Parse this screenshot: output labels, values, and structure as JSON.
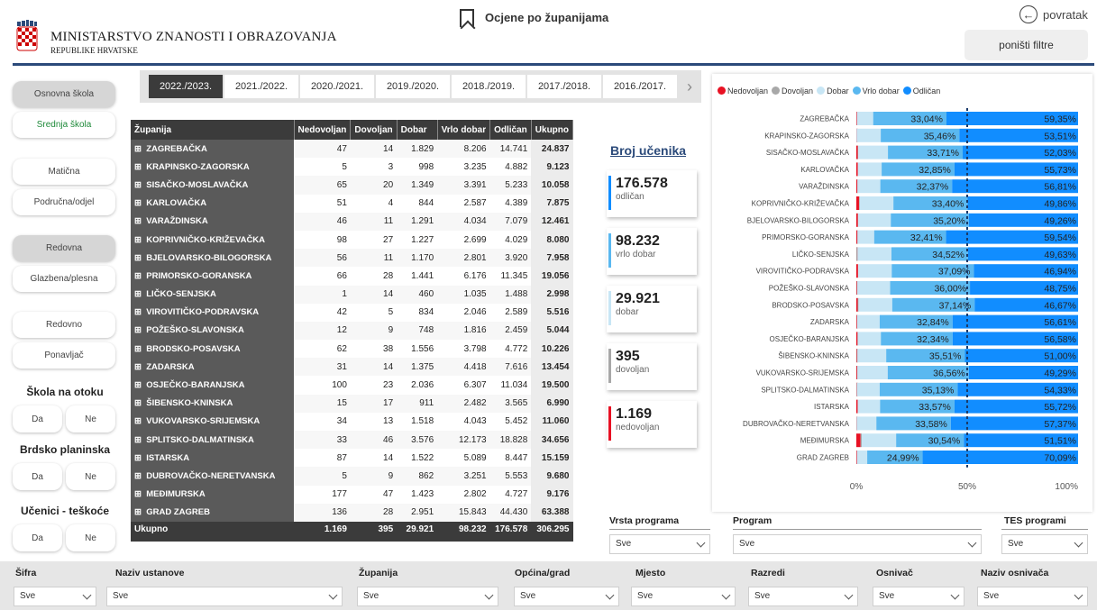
{
  "header": {
    "org_name": "MINISTARSTVO ZNANOSTI I OBRAZOVANJA",
    "org_sub": "REPUBLIKE HRVATSKE",
    "page_title": "Ocjene po županijama",
    "back_label": "povratak",
    "reset_label": "poništi filtre"
  },
  "left_filters": {
    "school_type": [
      "Osnovna škola",
      "Srednja škola"
    ],
    "school_kind": [
      "Matična",
      "Područna/odjel"
    ],
    "program_kind": [
      "Redovna",
      "Glazbena/plesna"
    ],
    "student_kind": [
      "Redovno",
      "Ponavljač"
    ],
    "island_title": "Škola na otoku",
    "mountain_title": "Brdsko planinska",
    "difficulty_title": "Učenici - teškoće",
    "yes": "Da",
    "no": "Ne"
  },
  "year_tabs": [
    "2022./2023.",
    "2021./2022.",
    "2020./2021.",
    "2019./2020.",
    "2018./2019.",
    "2017./2018.",
    "2016./2017."
  ],
  "table": {
    "headers": [
      "Županija",
      "Nedovoljan",
      "Dovoljan",
      "Dobar",
      "Vrlo dobar",
      "Odličan",
      "Ukupno"
    ],
    "rows": [
      {
        "name": "ZAGREBAČKA",
        "v": [
          "47",
          "14",
          "1.829",
          "8.206",
          "14.741",
          "24.837"
        ]
      },
      {
        "name": "KRAPINSKO-ZAGORSKA",
        "v": [
          "5",
          "3",
          "998",
          "3.235",
          "4.882",
          "9.123"
        ]
      },
      {
        "name": "SISAČKO-MOSLAVAČKA",
        "v": [
          "65",
          "20",
          "1.349",
          "3.391",
          "5.233",
          "10.058"
        ]
      },
      {
        "name": "KARLOVAČKA",
        "v": [
          "51",
          "4",
          "844",
          "2.587",
          "4.389",
          "7.875"
        ]
      },
      {
        "name": "VARAŽDINSKA",
        "v": [
          "46",
          "11",
          "1.291",
          "4.034",
          "7.079",
          "12.461"
        ]
      },
      {
        "name": "KOPRIVNIČKO-KRIŽEVAČKA",
        "v": [
          "98",
          "27",
          "1.227",
          "2.699",
          "4.029",
          "8.080"
        ]
      },
      {
        "name": "BJELOVARSKO-BILOGORSKA",
        "v": [
          "56",
          "11",
          "1.170",
          "2.801",
          "3.920",
          "7.958"
        ]
      },
      {
        "name": "PRIMORSKO-GORANSKA",
        "v": [
          "66",
          "28",
          "1.441",
          "6.176",
          "11.345",
          "19.056"
        ]
      },
      {
        "name": "LIČKO-SENJSKA",
        "v": [
          "1",
          "14",
          "460",
          "1.035",
          "1.488",
          "2.998"
        ]
      },
      {
        "name": "VIROVITIČKO-PODRAVSKA",
        "v": [
          "42",
          "5",
          "834",
          "2.046",
          "2.589",
          "5.516"
        ]
      },
      {
        "name": "POŽEŠKO-SLAVONSKA",
        "v": [
          "12",
          "9",
          "748",
          "1.816",
          "2.459",
          "5.044"
        ]
      },
      {
        "name": "BRODSKO-POSAVSKA",
        "v": [
          "62",
          "38",
          "1.556",
          "3.798",
          "4.772",
          "10.226"
        ]
      },
      {
        "name": "ZADARSKA",
        "v": [
          "31",
          "14",
          "1.375",
          "4.418",
          "7.616",
          "13.454"
        ]
      },
      {
        "name": "OSJEČKO-BARANJSKA",
        "v": [
          "100",
          "23",
          "2.036",
          "6.307",
          "11.034",
          "19.500"
        ]
      },
      {
        "name": "ŠIBENSKO-KNINSKA",
        "v": [
          "15",
          "17",
          "911",
          "2.482",
          "3.565",
          "6.990"
        ]
      },
      {
        "name": "VUKOVARSKO-SRIJEMSKA",
        "v": [
          "34",
          "13",
          "1.518",
          "4.043",
          "5.452",
          "11.060"
        ]
      },
      {
        "name": "SPLITSKO-DALMATINSKA",
        "v": [
          "33",
          "46",
          "3.576",
          "12.173",
          "18.828",
          "34.656"
        ]
      },
      {
        "name": "ISTARSKA",
        "v": [
          "87",
          "14",
          "1.522",
          "5.089",
          "8.447",
          "15.159"
        ]
      },
      {
        "name": "DUBROVAČKO-NERETVANSKA",
        "v": [
          "5",
          "9",
          "862",
          "3.251",
          "5.553",
          "9.680"
        ]
      },
      {
        "name": "MEĐIMURSKA",
        "v": [
          "177",
          "47",
          "1.423",
          "2.802",
          "4.727",
          "9.176"
        ]
      },
      {
        "name": "GRAD ZAGREB",
        "v": [
          "136",
          "28",
          "2.951",
          "15.843",
          "44.430",
          "63.388"
        ]
      }
    ],
    "total": {
      "name": "Ukupno",
      "v": [
        "1.169",
        "395",
        "29.921",
        "98.232",
        "176.578",
        "306.295"
      ]
    }
  },
  "cards": {
    "title": "Broj učenika",
    "items": [
      {
        "value": "176.578",
        "label": "odličan",
        "color": "#118dff"
      },
      {
        "value": "98.232",
        "label": "vrlo dobar",
        "color": "#5ab8f0"
      },
      {
        "value": "29.921",
        "label": "dobar",
        "color": "#c8e6f5"
      },
      {
        "value": "395",
        "label": "dovoljan",
        "color": "#a8a8a8"
      },
      {
        "value": "1.169",
        "label": "nedovoljan",
        "color": "#e81123"
      }
    ]
  },
  "chart_data": {
    "type": "bar",
    "orientation": "horizontal-100%-stacked",
    "legend": [
      "Nedovoljan",
      "Dovoljan",
      "Dobar",
      "Vrlo dobar",
      "Odličan"
    ],
    "legend_colors": [
      "#e81123",
      "#a8a8a8",
      "#c8e6f5",
      "#5ab8f0",
      "#118dff"
    ],
    "categories": [
      "ZAGREBAČKA",
      "KRAPINSKO-ZAGORSKA",
      "SISAČKO-MOSLAVAČKA",
      "KARLOVAČKA",
      "VARAŽDINSKA",
      "KOPRIVNIČKO-KRIŽEVAČKA",
      "BJELOVARSKO-BILOGORSKA",
      "PRIMORSKO-GORANSKA",
      "LIČKO-SENJSKA",
      "VIROVITIČKO-PODRAVSKA",
      "POŽEŠKO-SLAVONSKA",
      "BRODSKO-POSAVSKA",
      "ZADARSKA",
      "OSJEČKO-BARANJSKA",
      "ŠIBENSKO-KNINSKA",
      "VUKOVARSKO-SRIJEMSKA",
      "SPLITSKO-DALMATINSKA",
      "ISTARSKA",
      "DUBROVAČKO-NERETVANSKA",
      "MEĐIMURSKA",
      "GRAD ZAGREB"
    ],
    "series": [
      {
        "name": "Nedovoljan",
        "values": [
          0.19,
          0.05,
          0.65,
          0.65,
          0.37,
          1.21,
          0.7,
          0.35,
          0.03,
          0.76,
          0.24,
          0.61,
          0.23,
          0.51,
          0.21,
          0.31,
          0.1,
          0.57,
          0.05,
          1.93,
          0.21
        ]
      },
      {
        "name": "Dovoljan",
        "values": [
          0.06,
          0.03,
          0.2,
          0.05,
          0.09,
          0.33,
          0.14,
          0.15,
          0.47,
          0.09,
          0.18,
          0.37,
          0.1,
          0.12,
          0.24,
          0.12,
          0.13,
          0.09,
          0.09,
          0.51,
          0.04
        ]
      },
      {
        "name": "Dobar",
        "values": [
          7.36,
          10.94,
          13.41,
          10.72,
          10.36,
          15.19,
          14.7,
          7.56,
          15.34,
          15.12,
          14.83,
          15.22,
          10.22,
          10.44,
          13.03,
          13.73,
          10.32,
          10.04,
          8.9,
          15.51,
          4.66
        ]
      },
      {
        "name": "Vrlo dobar",
        "values": [
          33.04,
          35.46,
          33.71,
          32.85,
          32.37,
          33.4,
          35.2,
          32.41,
          34.52,
          37.09,
          36.0,
          37.14,
          32.84,
          32.34,
          35.51,
          36.56,
          35.13,
          33.57,
          33.58,
          30.54,
          24.99
        ]
      },
      {
        "name": "Odličan",
        "values": [
          59.35,
          53.51,
          52.03,
          55.73,
          56.81,
          49.86,
          49.26,
          59.54,
          49.63,
          46.94,
          48.75,
          46.67,
          56.61,
          56.58,
          51.0,
          49.29,
          54.33,
          55.72,
          57.37,
          51.51,
          70.09
        ]
      }
    ],
    "vrlo_labels": [
      "33,04%",
      "35,46%",
      "33,71%",
      "32,85%",
      "32,37%",
      "33,40%",
      "35,20%",
      "32,41%",
      "34,52%",
      "37,09%",
      "36,00%",
      "37,14%",
      "32,84%",
      "32,34%",
      "35,51%",
      "36,56%",
      "35,13%",
      "33,57%",
      "33,58%",
      "30,54%",
      "24,99%"
    ],
    "odlican_labels": [
      "59,35%",
      "53,51%",
      "52,03%",
      "55,73%",
      "56,81%",
      "49,86%",
      "49,26%",
      "59,54%",
      "49,63%",
      "46,94%",
      "48,75%",
      "46,67%",
      "56,61%",
      "56,58%",
      "51,00%",
      "49,29%",
      "54,33%",
      "55,72%",
      "57,37%",
      "51,51%",
      "70,09%"
    ],
    "xlim": [
      0,
      100
    ],
    "x_ticks": [
      "0%",
      "50%",
      "100%"
    ],
    "reference_line": 50
  },
  "mid_filters": {
    "vrsta_label": "Vrsta programa",
    "program_label": "Program",
    "tes_label": "TES programi",
    "value": "Sve"
  },
  "bottom_filters": [
    {
      "label": "Šifra",
      "value": "Sve"
    },
    {
      "label": "Naziv ustanove",
      "value": "Sve"
    },
    {
      "label": "Županija",
      "value": "Sve"
    },
    {
      "label": "Općina/grad",
      "value": "Sve"
    },
    {
      "label": "Mjesto",
      "value": "Sve"
    },
    {
      "label": "Razredi",
      "value": "Sve"
    },
    {
      "label": "Osnivač",
      "value": "Sve"
    },
    {
      "label": "Naziv osnivača",
      "value": "Sve"
    }
  ]
}
